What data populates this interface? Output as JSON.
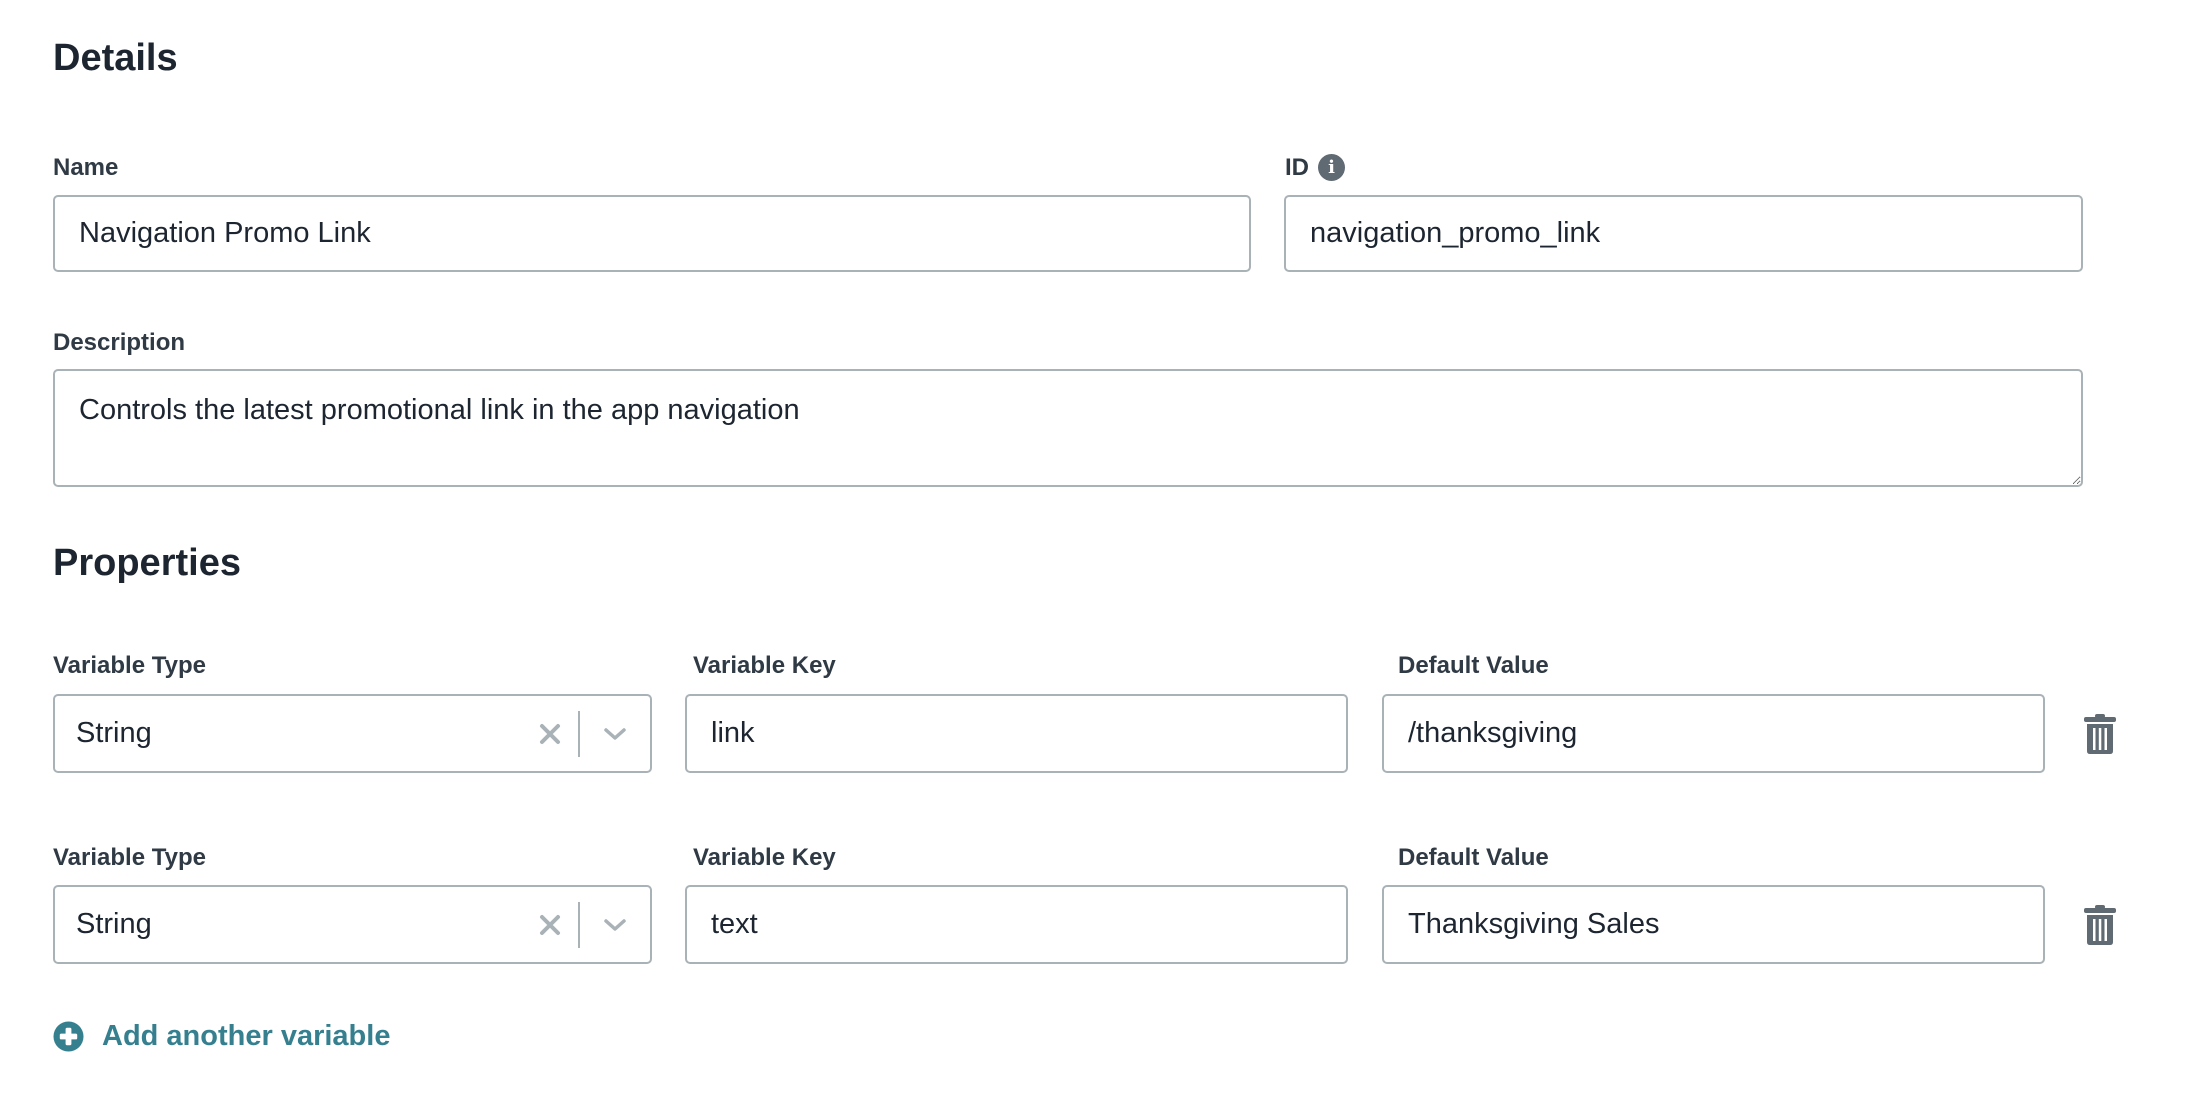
{
  "details": {
    "heading": "Details",
    "name": {
      "label": "Name",
      "value": "Navigation Promo Link"
    },
    "id": {
      "label": "ID",
      "info_icon": "info-circle-icon",
      "value": "navigation_promo_link"
    },
    "description": {
      "label": "Description",
      "value": "Controls the latest promotional link in the app navigation"
    }
  },
  "properties": {
    "heading": "Properties",
    "labels": {
      "variable_type": "Variable Type",
      "variable_key": "Variable Key",
      "default_value": "Default Value"
    },
    "variables": [
      {
        "type": "String",
        "key": "link",
        "default_value": "/thanksgiving"
      },
      {
        "type": "String",
        "key": "text",
        "default_value": "Thanksgiving Sales"
      }
    ],
    "icons": {
      "clear": "close-x-icon",
      "dropdown": "chevron-down-icon",
      "delete": "trash-icon",
      "add": "plus-circle-icon"
    },
    "add_label": "Add another variable"
  },
  "colors": {
    "heading_text": "#1c2530",
    "label_text": "#2f3a45",
    "input_border": "#a9b2b7",
    "icon_gray": "#5f6a73",
    "accent_link": "#357f8f"
  }
}
